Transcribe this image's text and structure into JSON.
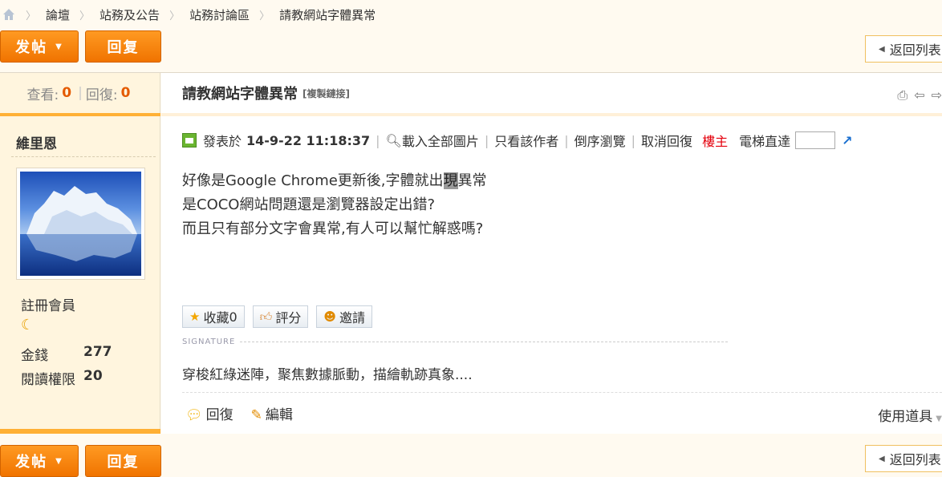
{
  "breadcrumb": [
    "論壇",
    "站務及公告",
    "站務討論區",
    "請教網站字體異常"
  ],
  "toolbar": {
    "post_label": "发帖",
    "reply_label": "回复",
    "back_label": "返回列表"
  },
  "stats": {
    "views_label": "查看:",
    "views": "0",
    "replies_label": "回復:",
    "replies": "0"
  },
  "post": {
    "title": "請教網站字體異常",
    "copy_link": "[複製鏈接]",
    "meta": {
      "posted_label": "發表於",
      "time": "14-9-22 11:18:37",
      "load_images": "載入全部圖片",
      "author_only": "只看該作者",
      "reverse": "倒序瀏覽",
      "cancel_reply": "取消回復",
      "owner": "樓主",
      "elevator": "電梯直達"
    },
    "body": {
      "line1_a": "好像是Google Chrome更新後,字體就出",
      "line1_hl": "現",
      "line1_b": "異常",
      "line2": "是COCO網站問題還是瀏覽器設定出錯?",
      "line3": "而且只有部分文字會異常,有人可以幫忙解惑嗎?"
    },
    "actions": {
      "favorite": "收藏",
      "favorite_count": "0",
      "rate": "評分",
      "invite": "邀請"
    },
    "signature_label": "SIGNATURE",
    "signature": "穿梭紅綠迷陣，聚焦數據脈動，描繪軌跡真象....",
    "footer": {
      "reply": "回復",
      "edit": "編輯",
      "tools": "使用道具"
    }
  },
  "author": {
    "name": "維里恩",
    "group": "註冊會員",
    "money_label": "金錢",
    "money": "277",
    "read_label": "閱讀權限",
    "read": "20"
  },
  "colors": {
    "accent": "#f07300",
    "highlight_bar": "#ffb035",
    "owner": "#e4000c"
  }
}
